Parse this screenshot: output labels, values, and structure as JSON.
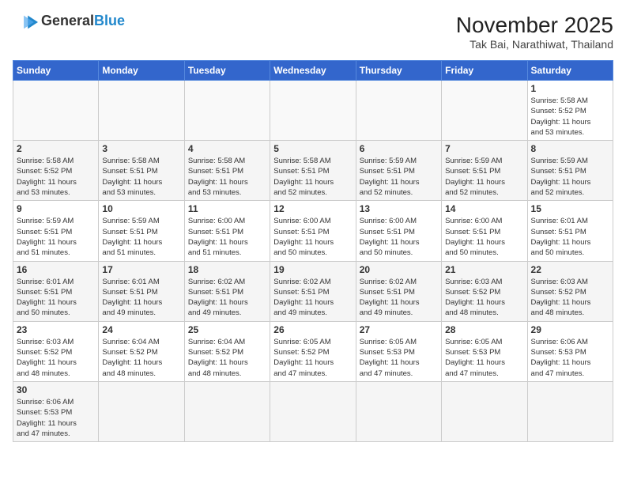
{
  "header": {
    "logo_general": "General",
    "logo_blue": "Blue",
    "title": "November 2025",
    "subtitle": "Tak Bai, Narathiwat, Thailand"
  },
  "days_of_week": [
    "Sunday",
    "Monday",
    "Tuesday",
    "Wednesday",
    "Thursday",
    "Friday",
    "Saturday"
  ],
  "weeks": [
    [
      {
        "day": "",
        "info": ""
      },
      {
        "day": "",
        "info": ""
      },
      {
        "day": "",
        "info": ""
      },
      {
        "day": "",
        "info": ""
      },
      {
        "day": "",
        "info": ""
      },
      {
        "day": "",
        "info": ""
      },
      {
        "day": "1",
        "info": "Sunrise: 5:58 AM\nSunset: 5:52 PM\nDaylight: 11 hours\nand 53 minutes."
      }
    ],
    [
      {
        "day": "2",
        "info": "Sunrise: 5:58 AM\nSunset: 5:52 PM\nDaylight: 11 hours\nand 53 minutes."
      },
      {
        "day": "3",
        "info": "Sunrise: 5:58 AM\nSunset: 5:51 PM\nDaylight: 11 hours\nand 53 minutes."
      },
      {
        "day": "4",
        "info": "Sunrise: 5:58 AM\nSunset: 5:51 PM\nDaylight: 11 hours\nand 53 minutes."
      },
      {
        "day": "5",
        "info": "Sunrise: 5:58 AM\nSunset: 5:51 PM\nDaylight: 11 hours\nand 52 minutes."
      },
      {
        "day": "6",
        "info": "Sunrise: 5:59 AM\nSunset: 5:51 PM\nDaylight: 11 hours\nand 52 minutes."
      },
      {
        "day": "7",
        "info": "Sunrise: 5:59 AM\nSunset: 5:51 PM\nDaylight: 11 hours\nand 52 minutes."
      },
      {
        "day": "8",
        "info": "Sunrise: 5:59 AM\nSunset: 5:51 PM\nDaylight: 11 hours\nand 52 minutes."
      }
    ],
    [
      {
        "day": "9",
        "info": "Sunrise: 5:59 AM\nSunset: 5:51 PM\nDaylight: 11 hours\nand 51 minutes."
      },
      {
        "day": "10",
        "info": "Sunrise: 5:59 AM\nSunset: 5:51 PM\nDaylight: 11 hours\nand 51 minutes."
      },
      {
        "day": "11",
        "info": "Sunrise: 6:00 AM\nSunset: 5:51 PM\nDaylight: 11 hours\nand 51 minutes."
      },
      {
        "day": "12",
        "info": "Sunrise: 6:00 AM\nSunset: 5:51 PM\nDaylight: 11 hours\nand 50 minutes."
      },
      {
        "day": "13",
        "info": "Sunrise: 6:00 AM\nSunset: 5:51 PM\nDaylight: 11 hours\nand 50 minutes."
      },
      {
        "day": "14",
        "info": "Sunrise: 6:00 AM\nSunset: 5:51 PM\nDaylight: 11 hours\nand 50 minutes."
      },
      {
        "day": "15",
        "info": "Sunrise: 6:01 AM\nSunset: 5:51 PM\nDaylight: 11 hours\nand 50 minutes."
      }
    ],
    [
      {
        "day": "16",
        "info": "Sunrise: 6:01 AM\nSunset: 5:51 PM\nDaylight: 11 hours\nand 50 minutes."
      },
      {
        "day": "17",
        "info": "Sunrise: 6:01 AM\nSunset: 5:51 PM\nDaylight: 11 hours\nand 49 minutes."
      },
      {
        "day": "18",
        "info": "Sunrise: 6:02 AM\nSunset: 5:51 PM\nDaylight: 11 hours\nand 49 minutes."
      },
      {
        "day": "19",
        "info": "Sunrise: 6:02 AM\nSunset: 5:51 PM\nDaylight: 11 hours\nand 49 minutes."
      },
      {
        "day": "20",
        "info": "Sunrise: 6:02 AM\nSunset: 5:51 PM\nDaylight: 11 hours\nand 49 minutes."
      },
      {
        "day": "21",
        "info": "Sunrise: 6:03 AM\nSunset: 5:52 PM\nDaylight: 11 hours\nand 48 minutes."
      },
      {
        "day": "22",
        "info": "Sunrise: 6:03 AM\nSunset: 5:52 PM\nDaylight: 11 hours\nand 48 minutes."
      }
    ],
    [
      {
        "day": "23",
        "info": "Sunrise: 6:03 AM\nSunset: 5:52 PM\nDaylight: 11 hours\nand 48 minutes."
      },
      {
        "day": "24",
        "info": "Sunrise: 6:04 AM\nSunset: 5:52 PM\nDaylight: 11 hours\nand 48 minutes."
      },
      {
        "day": "25",
        "info": "Sunrise: 6:04 AM\nSunset: 5:52 PM\nDaylight: 11 hours\nand 48 minutes."
      },
      {
        "day": "26",
        "info": "Sunrise: 6:05 AM\nSunset: 5:52 PM\nDaylight: 11 hours\nand 47 minutes."
      },
      {
        "day": "27",
        "info": "Sunrise: 6:05 AM\nSunset: 5:53 PM\nDaylight: 11 hours\nand 47 minutes."
      },
      {
        "day": "28",
        "info": "Sunrise: 6:05 AM\nSunset: 5:53 PM\nDaylight: 11 hours\nand 47 minutes."
      },
      {
        "day": "29",
        "info": "Sunrise: 6:06 AM\nSunset: 5:53 PM\nDaylight: 11 hours\nand 47 minutes."
      }
    ],
    [
      {
        "day": "30",
        "info": "Sunrise: 6:06 AM\nSunset: 5:53 PM\nDaylight: 11 hours\nand 47 minutes."
      },
      {
        "day": "",
        "info": ""
      },
      {
        "day": "",
        "info": ""
      },
      {
        "day": "",
        "info": ""
      },
      {
        "day": "",
        "info": ""
      },
      {
        "day": "",
        "info": ""
      },
      {
        "day": "",
        "info": ""
      }
    ]
  ]
}
